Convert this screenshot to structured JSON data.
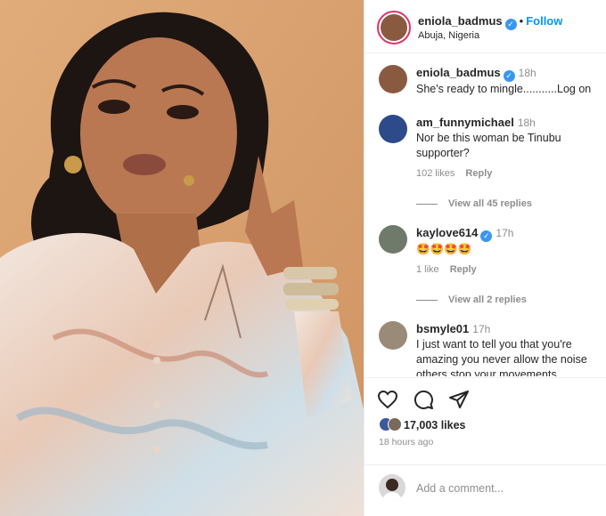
{
  "post": {
    "author": "eniola_badmus",
    "follow_label": "Follow",
    "location": "Abuja, Nigeria"
  },
  "caption": {
    "username": "eniola_badmus",
    "time": "18h",
    "text": "She's ready to mingle...........Log on"
  },
  "comments": [
    {
      "username": "am_funnymichael",
      "time": "18h",
      "text": "Nor be this woman be Tinubu supporter?",
      "likes": "102 likes",
      "reply": "Reply",
      "view_replies": "View all 45 replies"
    },
    {
      "username": "kaylove614",
      "verified": true,
      "time": "17h",
      "text": "🤩🤩🤩🤩",
      "likes": "1 like",
      "reply": "Reply",
      "view_replies": "View all 2 replies"
    },
    {
      "username": "bsmyle01",
      "time": "17h",
      "text": "I just want to tell you that you're amazing you never allow the noise others stop your movements"
    }
  ],
  "actions": {
    "like_icon": "heart-icon",
    "comment_icon": "comment-bubble-icon",
    "share_icon": "paper-plane-icon",
    "likes_count": "17,003 likes",
    "posted_ago": "18 hours ago"
  },
  "add_comment": {
    "placeholder": "Add a comment..."
  },
  "colors": {
    "follow": "#0095f6",
    "verified": "#3897f0",
    "photo_background": "#d9a06f"
  }
}
